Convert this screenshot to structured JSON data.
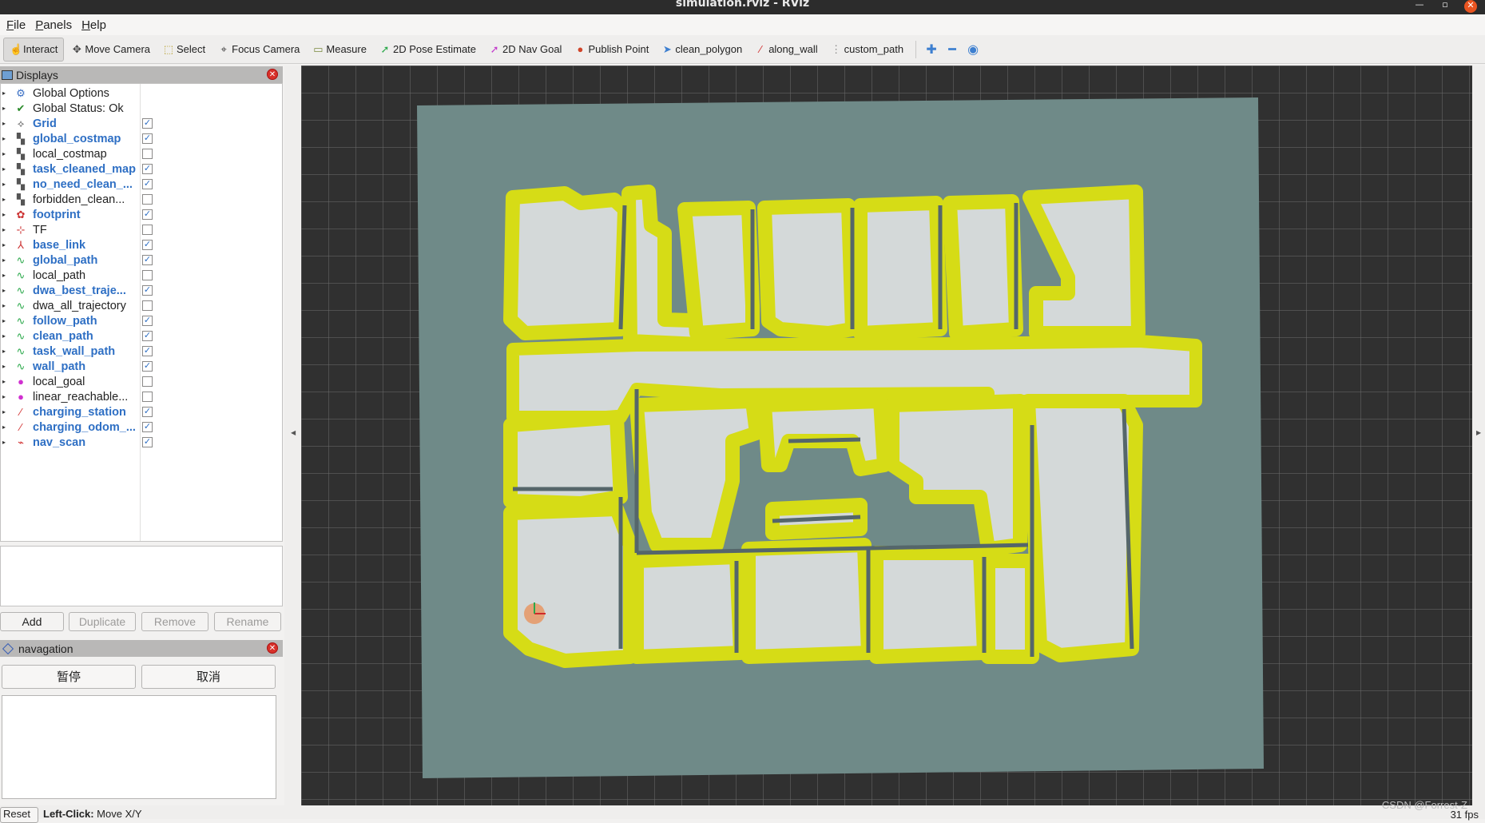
{
  "window": {
    "title": "simulation.rviz - RViz"
  },
  "menu": [
    "File",
    "Panels",
    "Help"
  ],
  "toolbar": {
    "tools": [
      {
        "label": "Interact",
        "icon": "hand-icon",
        "glyph": "☝",
        "color": "#444",
        "active": true
      },
      {
        "label": "Move Camera",
        "icon": "move-camera-icon",
        "glyph": "✥",
        "color": "#444"
      },
      {
        "label": "Select",
        "icon": "select-icon",
        "glyph": "⬚",
        "color": "#b8a030"
      },
      {
        "label": "Focus Camera",
        "icon": "focus-camera-icon",
        "glyph": "⌖",
        "color": "#444"
      },
      {
        "label": "Measure",
        "icon": "ruler-icon",
        "glyph": "▭",
        "color": "#7a8a40"
      },
      {
        "label": "2D Pose Estimate",
        "icon": "pose-arrow-icon",
        "glyph": "➚",
        "color": "#2aa84a"
      },
      {
        "label": "2D Nav Goal",
        "icon": "goal-arrow-icon",
        "glyph": "➚",
        "color": "#c23acb"
      },
      {
        "label": "Publish Point",
        "icon": "map-pin-icon",
        "glyph": "●",
        "color": "#d0452a"
      },
      {
        "label": "clean_polygon",
        "icon": "polygon-cursor-icon",
        "glyph": "➤",
        "color": "#3d7fd0"
      },
      {
        "label": "along_wall",
        "icon": "wall-arrow-icon",
        "glyph": "∕",
        "color": "#d02a2a"
      },
      {
        "label": "custom_path",
        "icon": "path-dots-icon",
        "glyph": "⋮",
        "color": "#888"
      }
    ]
  },
  "displays": {
    "title": "Displays",
    "items": [
      {
        "label": "Global Options",
        "icon": "gear-icon",
        "glyph": "⚙",
        "color": "#3a6fc4",
        "enabled": false,
        "checkbox": false
      },
      {
        "label": "Global Status: Ok",
        "icon": "check-icon",
        "glyph": "✔",
        "color": "#2a8a2a",
        "enabled": false,
        "checkbox": false
      },
      {
        "label": "Grid",
        "icon": "grid-icon",
        "glyph": "⟡",
        "color": "#555",
        "enabled": true,
        "checkbox": true,
        "checked": true
      },
      {
        "label": "global_costmap",
        "icon": "map-icon",
        "glyph": "▚",
        "color": "#555",
        "enabled": true,
        "checkbox": true,
        "checked": true
      },
      {
        "label": "local_costmap",
        "icon": "map-icon",
        "glyph": "▚",
        "color": "#555",
        "enabled": false,
        "checkbox": true,
        "checked": false
      },
      {
        "label": "task_cleaned_map",
        "icon": "map-icon",
        "glyph": "▚",
        "color": "#555",
        "enabled": true,
        "checkbox": true,
        "checked": true
      },
      {
        "label": "no_need_clean_...",
        "icon": "map-icon",
        "glyph": "▚",
        "color": "#555",
        "enabled": true,
        "checkbox": true,
        "checked": true
      },
      {
        "label": "forbidden_clean...",
        "icon": "map-icon",
        "glyph": "▚",
        "color": "#555",
        "enabled": false,
        "checkbox": true,
        "checked": false
      },
      {
        "label": "footprint",
        "icon": "polygon-icon",
        "glyph": "✿",
        "color": "#c33",
        "enabled": true,
        "checkbox": true,
        "checked": true
      },
      {
        "label": "TF",
        "icon": "axes-icon",
        "glyph": "⊹",
        "color": "#c33",
        "enabled": false,
        "checkbox": true,
        "checked": false
      },
      {
        "label": "base_link",
        "icon": "axes-icon",
        "glyph": "⅄",
        "color": "#c33",
        "enabled": true,
        "checkbox": true,
        "checked": true
      },
      {
        "label": "global_path",
        "icon": "path-icon",
        "glyph": "∿",
        "color": "#2aa84a",
        "enabled": true,
        "checkbox": true,
        "checked": true
      },
      {
        "label": "local_path",
        "icon": "path-icon",
        "glyph": "∿",
        "color": "#2aa84a",
        "enabled": false,
        "checkbox": true,
        "checked": false
      },
      {
        "label": "dwa_best_traje...",
        "icon": "path-icon",
        "glyph": "∿",
        "color": "#2aa84a",
        "enabled": true,
        "checkbox": true,
        "checked": true
      },
      {
        "label": "dwa_all_trajectory",
        "icon": "path-icon",
        "glyph": "∿",
        "color": "#2aa84a",
        "enabled": false,
        "checkbox": true,
        "checked": false
      },
      {
        "label": "follow_path",
        "icon": "path-icon",
        "glyph": "∿",
        "color": "#2aa84a",
        "enabled": true,
        "checkbox": true,
        "checked": true
      },
      {
        "label": "clean_path",
        "icon": "path-icon",
        "glyph": "∿",
        "color": "#2aa84a",
        "enabled": true,
        "checkbox": true,
        "checked": true
      },
      {
        "label": "task_wall_path",
        "icon": "path-icon",
        "glyph": "∿",
        "color": "#2aa84a",
        "enabled": true,
        "checkbox": true,
        "checked": true
      },
      {
        "label": "wall_path",
        "icon": "path-icon",
        "glyph": "∿",
        "color": "#2aa84a",
        "enabled": true,
        "checkbox": true,
        "checked": true
      },
      {
        "label": "local_goal",
        "icon": "point-icon",
        "glyph": "●",
        "color": "#d030d0",
        "enabled": false,
        "checkbox": true,
        "checked": false
      },
      {
        "label": "linear_reachable...",
        "icon": "point-icon",
        "glyph": "●",
        "color": "#d030d0",
        "enabled": false,
        "checkbox": true,
        "checked": false
      },
      {
        "label": "charging_station",
        "icon": "pose-icon",
        "glyph": "∕",
        "color": "#d02a2a",
        "enabled": true,
        "checkbox": true,
        "checked": true
      },
      {
        "label": "charging_odom_...",
        "icon": "pose-icon",
        "glyph": "∕",
        "color": "#d02a2a",
        "enabled": true,
        "checkbox": true,
        "checked": true
      },
      {
        "label": "nav_scan",
        "icon": "laser-scan-icon",
        "glyph": "⌁",
        "color": "#d02a2a",
        "enabled": true,
        "checkbox": true,
        "checked": true
      }
    ],
    "buttons": {
      "add": "Add",
      "duplicate": "Duplicate",
      "remove": "Remove",
      "rename": "Rename"
    }
  },
  "navagation": {
    "title": "navagation",
    "pause": "暂停",
    "cancel": "取消"
  },
  "status": {
    "reset": "Reset",
    "hint_bold": "Left-Click:",
    "hint": " Move X/Y",
    "fps": "31 fps",
    "watermark": "CSDN @Forrest-Z"
  }
}
